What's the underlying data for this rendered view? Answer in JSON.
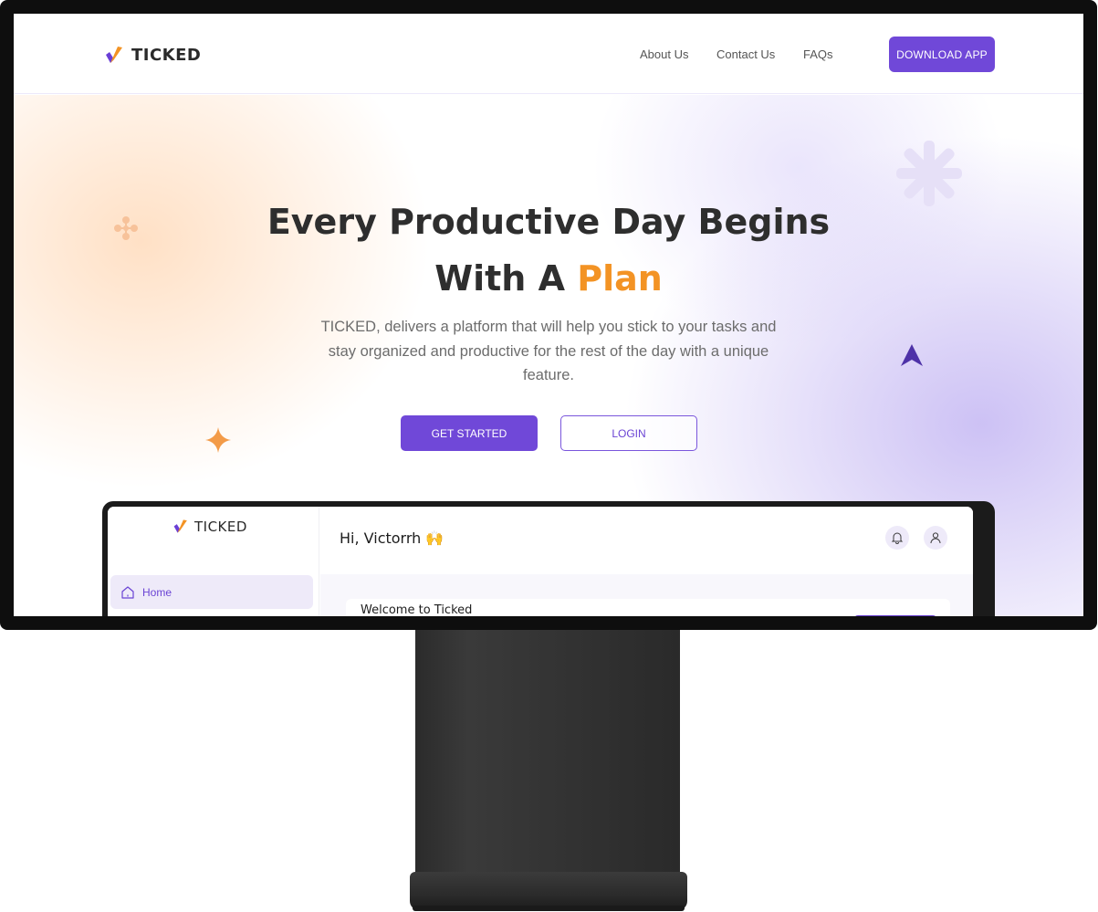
{
  "brand": {
    "name": "TICKED",
    "accent_color": "#7048d8",
    "highlight_color": "#f39324"
  },
  "nav": {
    "links": [
      "About Us",
      "Contact Us",
      "FAQs"
    ],
    "cta_label": "DOWNLOAD APP"
  },
  "hero": {
    "title_line1": "Every Productive Day Begins",
    "title_line2_prefix": "With A ",
    "title_line2_highlight": "Plan",
    "subtitle": "TICKED, delivers a platform that will help you stick to your tasks and stay organized and productive for the rest of the day with a unique feature.",
    "primary_button": "GET STARTED",
    "secondary_button": "LOGIN"
  },
  "dashboard": {
    "logo_text": "TICKED",
    "sidebar_home": "Home",
    "greeting": "Hi, Victorrh 🙌",
    "welcome_card_title": "Welcome to Ticked",
    "icons": [
      "bell-icon",
      "user-icon",
      "home-icon"
    ]
  }
}
